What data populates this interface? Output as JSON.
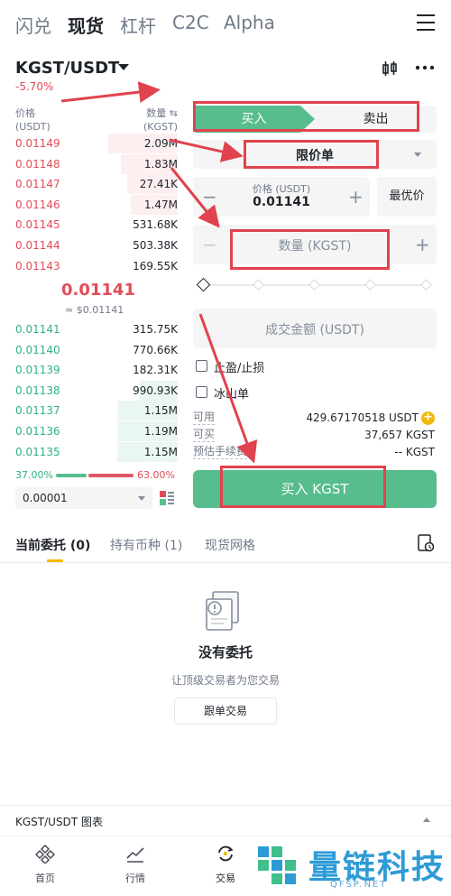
{
  "top_tabs": [
    "闪兑",
    "现货",
    "杠杆",
    "C2C",
    "Alpha"
  ],
  "pair": {
    "name": "KGST/USDT",
    "change": "-5.70%"
  },
  "orderbook": {
    "price_header": "价格",
    "price_unit": "(USDT)",
    "qty_header": "数量 ⇆",
    "qty_unit": "(KGST)",
    "asks": [
      {
        "price": "0.01149",
        "qty": "2.09M",
        "depth": 0.55
      },
      {
        "price": "0.01148",
        "qty": "1.83M",
        "depth": 0.45
      },
      {
        "price": "0.01147",
        "qty": "27.41K",
        "depth": 0.4
      },
      {
        "price": "0.01146",
        "qty": "1.47M",
        "depth": 0.37
      },
      {
        "price": "0.01145",
        "qty": "531.68K",
        "depth": 0
      },
      {
        "price": "0.01144",
        "qty": "503.38K",
        "depth": 0
      },
      {
        "price": "0.01143",
        "qty": "169.55K",
        "depth": 0
      }
    ],
    "mid_price": "0.01141",
    "mid_usd": "≈ $0.01141",
    "bids": [
      {
        "price": "0.01141",
        "qty": "315.75K",
        "depth": 0
      },
      {
        "price": "0.01140",
        "qty": "770.66K",
        "depth": 0
      },
      {
        "price": "0.01139",
        "qty": "182.31K",
        "depth": 0
      },
      {
        "price": "0.01138",
        "qty": "990.93K",
        "depth": 0.3
      },
      {
        "price": "0.01137",
        "qty": "1.15M",
        "depth": 0.48
      },
      {
        "price": "0.01136",
        "qty": "1.19M",
        "depth": 0.48
      },
      {
        "price": "0.01135",
        "qty": "1.15M",
        "depth": 0.48
      }
    ],
    "buy_ratio": "37.00%",
    "sell_ratio": "63.00%",
    "precision": "0.00001"
  },
  "trade": {
    "buy_tab": "买入",
    "sell_tab": "卖出",
    "order_type": "限价单",
    "price_label": "价格 (USDT)",
    "price_value": "0.01141",
    "best_price": "最优价",
    "qty_placeholder": "数量 (KGST)",
    "amount_placeholder": "成交金额 (USDT)",
    "tpsl_label": "止盈/止损",
    "iceberg_label": "冰山单",
    "available_label": "可用",
    "available_value": "429.67170518 USDT",
    "can_buy_label": "可买",
    "can_buy_value": "37,657 KGST",
    "fee_label": "预估手续费",
    "fee_value": "-- KGST",
    "buy_button": "买入 KGST",
    "minus": "−",
    "plus": "+"
  },
  "orders": {
    "tabs": [
      "当前委托 (0)",
      "持有币种 (1)",
      "现货网格"
    ],
    "empty_title": "没有委托",
    "empty_sub": "让顶级交易者为您交易",
    "copy_button": "跟单交易"
  },
  "chart_bar": "KGST/USDT 图表",
  "bottom_nav": [
    "首页",
    "行情",
    "交易"
  ],
  "watermark": {
    "text": "量链科技",
    "sub": "QFSP.NET"
  },
  "colors": {
    "buy": "#57bd8d",
    "sell": "#e24b58",
    "accent": "#f0b90b",
    "annotation": "#e0434e"
  }
}
